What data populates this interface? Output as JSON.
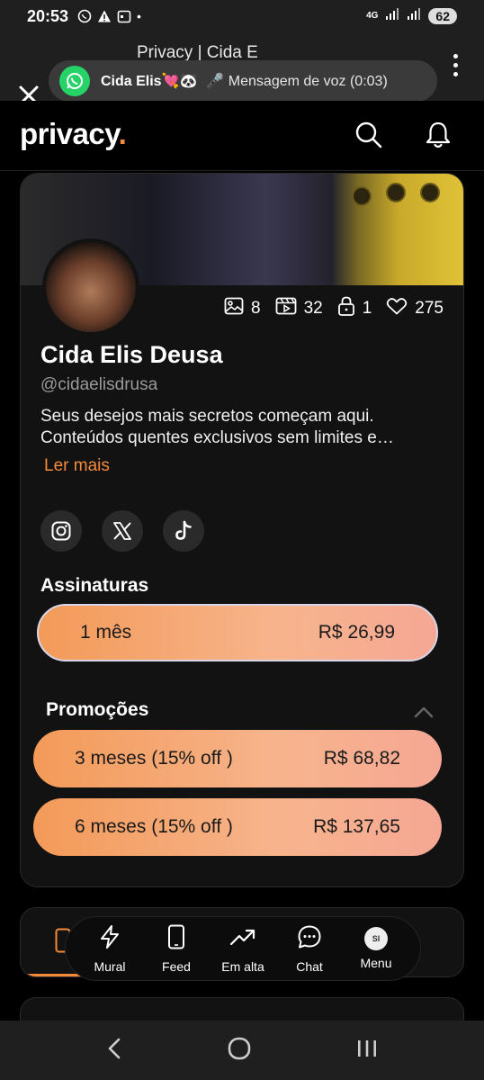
{
  "status_bar": {
    "time": "20:53",
    "dot": "•",
    "network": "4G",
    "battery": "62"
  },
  "browser": {
    "tab_title": "Privacy | Cida E",
    "close_icon": "close-icon",
    "menu_icon": "kebab-icon"
  },
  "notification": {
    "app": "WhatsApp",
    "sender": "Cida Elis💘🐼",
    "message": "🎤 Mensagem de voz (0:03)"
  },
  "header": {
    "logo_text": "privacy",
    "logo_dot": ".",
    "accent": "#f58a3a"
  },
  "profile": {
    "stats": {
      "images": "8",
      "videos": "32",
      "locked": "1",
      "likes": "275"
    },
    "name": "Cida Elis Deusa",
    "handle": "@cidaelisdrusa",
    "bio_line1": "Seus desejos mais secretos começam aqui.",
    "bio_line2": "Conteúdos quentes exclusivos sem limites e…",
    "read_more": "Ler mais"
  },
  "subscriptions": {
    "title": "Assinaturas",
    "plan": {
      "label": "1 mês",
      "price": "R$ 26,99"
    }
  },
  "promotions": {
    "title": "Promoções",
    "items": [
      {
        "label": "3 meses (15% off )",
        "price": "R$ 68,82"
      },
      {
        "label": "6 meses (15% off )",
        "price": "R$ 137,65"
      }
    ]
  },
  "bottom_nav": {
    "items": [
      {
        "label": "Mural",
        "icon": "lightning-icon"
      },
      {
        "label": "Feed",
        "icon": "phone-icon"
      },
      {
        "label": "Em alta",
        "icon": "trending-icon"
      },
      {
        "label": "Chat",
        "icon": "chat-icon"
      },
      {
        "label": "Menu",
        "icon": "avatar-icon"
      }
    ],
    "menu_initials": "SI"
  }
}
